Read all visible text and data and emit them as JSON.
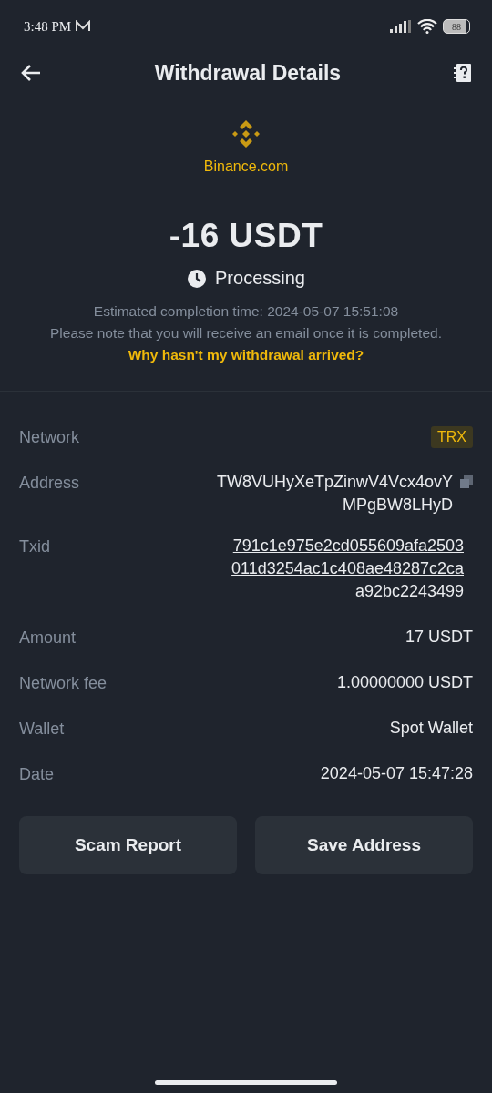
{
  "status_bar": {
    "time": "3:48 PM",
    "battery": "88"
  },
  "header": {
    "title": "Withdrawal Details"
  },
  "source": {
    "name": "Binance.com"
  },
  "amount": "-16 USDT",
  "status": {
    "label": "Processing"
  },
  "notes": [
    "Estimated completion time: 2024-05-07 15:51:08",
    "Please note that you will receive an email once it is completed."
  ],
  "help_link": "Why hasn't my withdrawal arrived?",
  "details": [
    {
      "kind": "tag",
      "label": "Network",
      "lines": [
        "TRX"
      ]
    },
    {
      "kind": "copy",
      "label": "Address",
      "lines": [
        "TW8VUHyXeTpZinwV4Vcx4ovY",
        "MPgBW8LHyD"
      ]
    },
    {
      "kind": "link",
      "label": "Txid",
      "lines": [
        "791c1e975e2cd055609afa2503",
        "011d3254ac1c408ae48287c2ca",
        "a92bc2243499"
      ]
    },
    {
      "kind": "text",
      "label": "Amount",
      "lines": [
        "17 USDT"
      ]
    },
    {
      "kind": "text",
      "label": "Network fee",
      "lines": [
        "1.00000000 USDT"
      ]
    },
    {
      "kind": "text",
      "label": "Wallet",
      "lines": [
        "Spot Wallet"
      ]
    },
    {
      "kind": "text",
      "label": "Date",
      "lines": [
        "2024-05-07 15:47:28"
      ]
    }
  ],
  "buttons": [
    "Scam Report",
    "Save Address"
  ]
}
